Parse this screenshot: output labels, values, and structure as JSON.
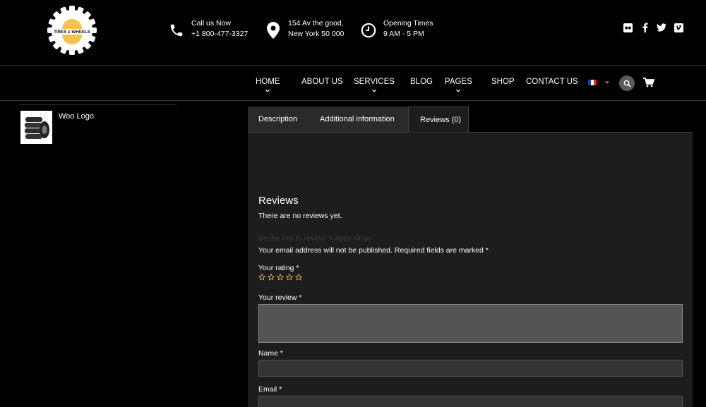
{
  "brand": {
    "logo_text_left": "TIRES",
    "logo_text_amp": "&",
    "logo_text_right": "WHEELS",
    "accent_color": "#f2c14e"
  },
  "contact": {
    "call": {
      "icon": "phone-icon",
      "line1": "Call us Now",
      "line2": "+1 800-477-3327"
    },
    "address": {
      "icon": "map-pin-icon",
      "line1": "154 Av the good,",
      "line2": "New York 50 000"
    },
    "hours": {
      "icon": "clock-icon",
      "line1": "Opening Times",
      "line2": "9 AM - 5 PM"
    }
  },
  "social": [
    "flickr-icon",
    "facebook-icon",
    "twitter-icon",
    "vimeo-icon"
  ],
  "nav": {
    "items": [
      {
        "label": "HOME",
        "has_dropdown": true
      },
      {
        "label": "ABOUT US",
        "has_dropdown": false
      },
      {
        "label": "SERVICES",
        "has_dropdown": true
      },
      {
        "label": "BLOG",
        "has_dropdown": false
      },
      {
        "label": "PAGES",
        "has_dropdown": true
      },
      {
        "label": "SHOP",
        "has_dropdown": false
      },
      {
        "label": "CONTACT US",
        "has_dropdown": false
      }
    ],
    "language_flag": "fr-flag-icon",
    "search_icon": "search-icon",
    "cart_icon": "cart-icon"
  },
  "sidebar": {
    "product": {
      "name": "Woo Logo",
      "thumb_icon": "tires-thumbnail"
    }
  },
  "tabs": [
    {
      "label": "Description",
      "active": false
    },
    {
      "label": "Additional information",
      "active": false
    },
    {
      "label": "Reviews (0)",
      "active": true
    }
  ],
  "reviews": {
    "title": "Reviews",
    "empty_text": "There are no reviews yet.",
    "first_review_text": "Be the first to review “Happy Ninja”",
    "email_notice": "Your email address will not be published. Required fields are marked *",
    "rating_label": "Your rating *",
    "rating_max": 5,
    "review_label": "Your review *",
    "review_value": "",
    "name_label": "Name *",
    "name_value": "",
    "email_label": "Email *",
    "email_value": ""
  }
}
